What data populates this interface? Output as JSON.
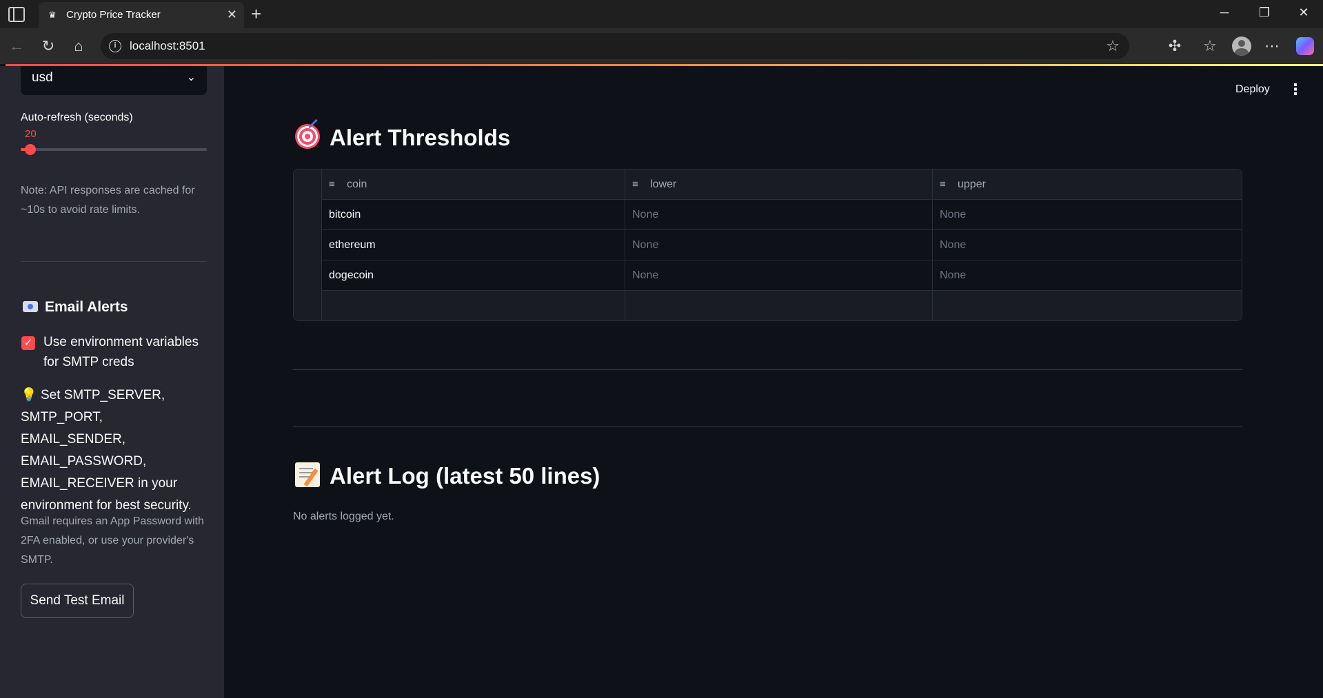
{
  "browser": {
    "tab_title": "Crypto Price Tracker",
    "tab_favicon": "crown-icon",
    "url": "localhost:8501",
    "window_controls": [
      "minimize-icon",
      "restore-icon",
      "close-icon"
    ]
  },
  "sidebar": {
    "currency_value": "usd",
    "refresh_label": "Auto-refresh (seconds)",
    "refresh_value": "20",
    "refresh_level": 0.03,
    "note": "Note: API responses are cached for ~10s to avoid rate limits.",
    "email_heading": "Email Alerts",
    "env_checkbox_label": "Use environment variables for SMTP creds",
    "env_checkbox_checked": true,
    "tip_emoji": "💡",
    "tip_text": "Set SMTP_SERVER, SMTP_PORT, EMAIL_SENDER, EMAIL_PASSWORD, EMAIL_RECEIVER in your environment for best security.",
    "gmail_note": "Gmail requires an App Password with 2FA enabled, or use your provider's SMTP.",
    "test_button": "Send Test Email"
  },
  "header": {
    "deploy": "Deploy",
    "menu": "⋮"
  },
  "thresholds": {
    "title": "Alert Thresholds",
    "columns": [
      "coin",
      "lower",
      "upper"
    ],
    "rows": [
      {
        "coin": "bitcoin",
        "lower": "None",
        "upper": "None"
      },
      {
        "coin": "ethereum",
        "lower": "None",
        "upper": "None"
      },
      {
        "coin": "dogecoin",
        "lower": "None",
        "upper": "None"
      }
    ]
  },
  "log": {
    "title": "Alert Log (latest 50 lines)",
    "empty_text": "No alerts logged yet."
  },
  "colors": {
    "accent": "#ff4b4b",
    "background": "#0e1117",
    "sidebar": "#262730"
  }
}
